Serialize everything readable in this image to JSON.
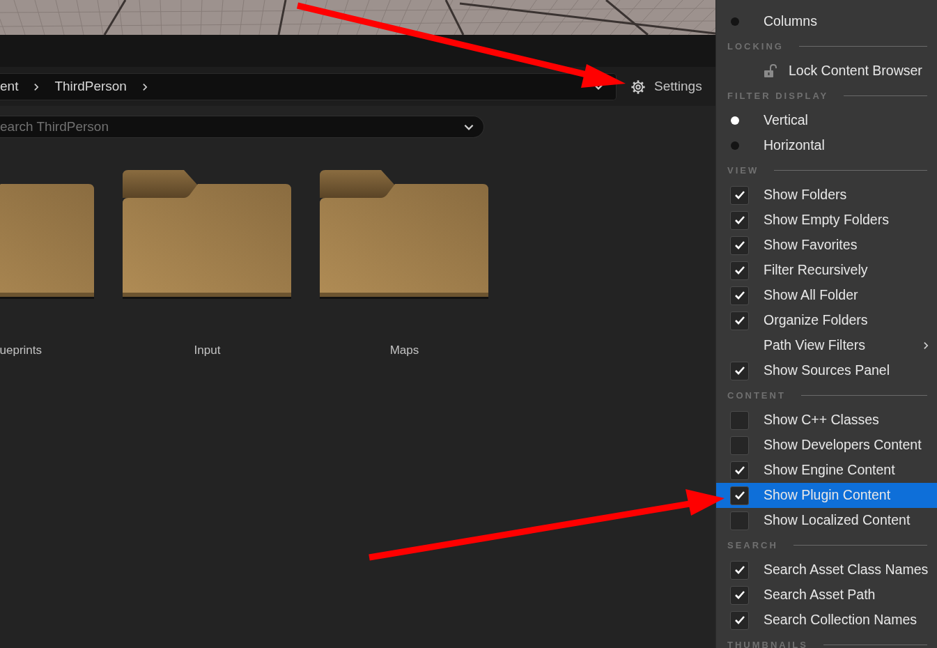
{
  "toolbar": {
    "breadcrumbs": [
      "ent",
      "ThirdPerson"
    ],
    "settings_label": "Settings"
  },
  "search": {
    "placeholder": "earch ThirdPerson"
  },
  "folders": [
    {
      "label": "ueprints"
    },
    {
      "label": "Input"
    },
    {
      "label": "Maps"
    }
  ],
  "menu": {
    "sections": [
      {
        "items": [
          {
            "kind": "radio",
            "label": "Columns",
            "selected": false,
            "highlighted": false
          }
        ]
      },
      {
        "title": "LOCKING",
        "items": [
          {
            "kind": "action",
            "label": "Lock Content Browser",
            "highlighted": false
          }
        ]
      },
      {
        "title": "FILTER DISPLAY",
        "items": [
          {
            "kind": "radio",
            "label": "Vertical",
            "selected": true,
            "highlighted": false
          },
          {
            "kind": "radio",
            "label": "Horizontal",
            "selected": false,
            "highlighted": false
          }
        ]
      },
      {
        "title": "VIEW",
        "items": [
          {
            "kind": "checkbox",
            "label": "Show Folders",
            "checked": true,
            "highlighted": false
          },
          {
            "kind": "checkbox",
            "label": "Show Empty Folders",
            "checked": true,
            "highlighted": false
          },
          {
            "kind": "checkbox",
            "label": "Show Favorites",
            "checked": true,
            "highlighted": false
          },
          {
            "kind": "checkbox",
            "label": "Filter Recursively",
            "checked": true,
            "highlighted": false
          },
          {
            "kind": "checkbox",
            "label": "Show All Folder",
            "checked": true,
            "highlighted": false
          },
          {
            "kind": "checkbox",
            "label": "Organize Folders",
            "checked": true,
            "highlighted": false
          },
          {
            "kind": "submenu",
            "label": "Path View Filters",
            "highlighted": false
          },
          {
            "kind": "checkbox",
            "label": "Show Sources Panel",
            "checked": true,
            "highlighted": false
          }
        ]
      },
      {
        "title": "CONTENT",
        "items": [
          {
            "kind": "checkbox",
            "label": "Show C++ Classes",
            "checked": false,
            "highlighted": false
          },
          {
            "kind": "checkbox",
            "label": "Show Developers Content",
            "checked": false,
            "highlighted": false
          },
          {
            "kind": "checkbox",
            "label": "Show Engine Content",
            "checked": true,
            "highlighted": false
          },
          {
            "kind": "checkbox",
            "label": "Show Plugin Content",
            "checked": true,
            "highlighted": true
          },
          {
            "kind": "checkbox",
            "label": "Show Localized Content",
            "checked": false,
            "highlighted": false
          }
        ]
      },
      {
        "title": "SEARCH",
        "items": [
          {
            "kind": "checkbox",
            "label": "Search Asset Class Names",
            "checked": true,
            "highlighted": false
          },
          {
            "kind": "checkbox",
            "label": "Search Asset Path",
            "checked": true,
            "highlighted": false
          },
          {
            "kind": "checkbox",
            "label": "Search Collection Names",
            "checked": true,
            "highlighted": false
          }
        ]
      },
      {
        "title": "THUMBNAILS"
      }
    ]
  }
}
